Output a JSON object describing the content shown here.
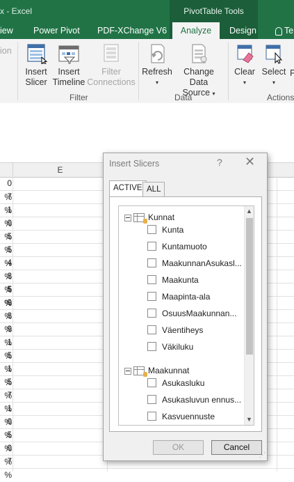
{
  "window": {
    "title_fragment": "x - Excel",
    "context_group": "PivotTable Tools"
  },
  "tabs": [
    {
      "label": "View",
      "display": "iew"
    },
    {
      "label": "Power Pivot"
    },
    {
      "label": "PDF-XChange V6"
    },
    {
      "label": "Analyze",
      "active": true
    },
    {
      "label": "Design"
    },
    {
      "label": "Tell me",
      "display": "Te"
    }
  ],
  "ribbon": {
    "left_cut_label": "ion",
    "filter_group": {
      "label": "Filter",
      "insert_slicer": [
        "Insert",
        "Slicer"
      ],
      "insert_timeline": [
        "Insert",
        "Timeline"
      ],
      "filter_connections": [
        "Filter",
        "Connections"
      ]
    },
    "data_group": {
      "label": "Data",
      "refresh": "Refresh",
      "change_source": [
        "Change Data",
        "Source"
      ]
    },
    "actions_group": {
      "label": "Actions",
      "clear": "Clear",
      "select": "Select",
      "cut": "P"
    }
  },
  "sheet": {
    "column_header": "E",
    "rows": [
      {
        "v": "0 %"
      },
      {
        "v": "7 %"
      },
      {
        "v": "1 %"
      },
      {
        "v": "0 %"
      },
      {
        "v": "5 %"
      },
      {
        "v": "5 %"
      },
      {
        "v": "4 %"
      },
      {
        "v": "8 %"
      },
      {
        "v": "5 %",
        "bold": true
      },
      {
        "v": "9 %"
      },
      {
        "v": "8 %"
      },
      {
        "v": "9 %"
      },
      {
        "v": "1 %"
      },
      {
        "v": "5 %"
      },
      {
        "v": "1 %"
      },
      {
        "v": "5 %"
      },
      {
        "v": "7 %"
      },
      {
        "v": "1 %"
      },
      {
        "v": "0 %"
      },
      {
        "v": "5 %"
      },
      {
        "v": "0 %"
      },
      {
        "v": "7 %"
      }
    ]
  },
  "dialog": {
    "title": "Insert Slicers",
    "help": "?",
    "close": "✕",
    "tabs": {
      "active": "ACTIVE",
      "all": "ALL"
    },
    "tables": [
      {
        "name": "Kunnat",
        "fields": [
          "Kunta",
          "Kuntamuoto",
          "MaakunnanAsukasl...",
          "Maakunta",
          "Maapinta-ala",
          "OsuusMaakunnan...",
          "Väentiheys",
          "Väkiluku"
        ]
      },
      {
        "name": "Maakunnat",
        "fields": [
          "Asukasluku",
          "Asukasluvun ennus...",
          "Kasvuennuste"
        ]
      }
    ],
    "ok": "OK",
    "cancel": "Cancel"
  }
}
